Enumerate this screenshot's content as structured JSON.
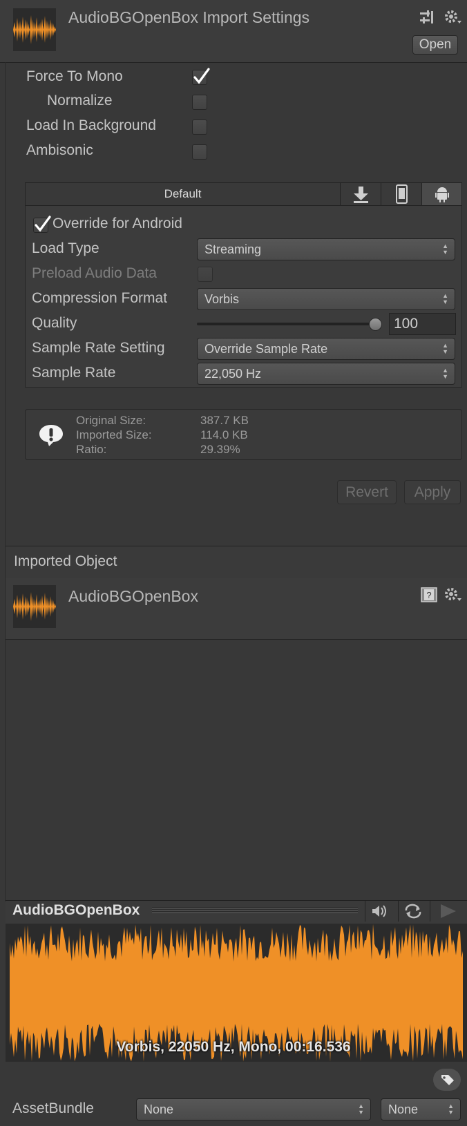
{
  "header": {
    "title": "AudioBGOpenBox Import Settings",
    "open_label": "Open",
    "icons": [
      "preset-sliders-icon",
      "gear-icon"
    ]
  },
  "options": {
    "force_to_mono": {
      "label": "Force To Mono",
      "checked": true
    },
    "normalize": {
      "label": "Normalize",
      "checked": false
    },
    "load_in_background": {
      "label": "Load In Background",
      "checked": false
    },
    "ambisonic": {
      "label": "Ambisonic",
      "checked": false
    }
  },
  "platform_tabs": {
    "default_label": "Default",
    "icons": [
      "download-icon",
      "mobile-phone-icon",
      "android-icon"
    ]
  },
  "android": {
    "override_label": "Override for Android",
    "override_checked": true,
    "load_type_label": "Load Type",
    "load_type_value": "Streaming",
    "preload_label": "Preload Audio Data",
    "compression_label": "Compression Format",
    "compression_value": "Vorbis",
    "quality_label": "Quality",
    "quality_value": "100",
    "sample_rate_setting_label": "Sample Rate Setting",
    "sample_rate_setting_value": "Override Sample Rate",
    "sample_rate_label": "Sample Rate",
    "sample_rate_value": "22,050 Hz"
  },
  "info": {
    "original_label": "Original Size:",
    "original_value": "387.7 KB",
    "imported_label": "Imported Size:",
    "imported_value": "114.0 KB",
    "ratio_label": "Ratio:",
    "ratio_value": "29.39%"
  },
  "actions": {
    "revert": "Revert",
    "apply": "Apply"
  },
  "imported_object": {
    "section_title": "Imported Object",
    "name": "AudioBGOpenBox",
    "icons": [
      "help-book-icon",
      "gear-icon"
    ]
  },
  "preview": {
    "title": "AudioBGOpenBox",
    "caption": "Vorbis, 22050 Hz, Mono, 00:16.536",
    "icons": [
      "speaker-icon",
      "loop-icon",
      "play-icon",
      "tag-icon"
    ],
    "waveform_color": "#ef9027"
  },
  "asset_bundle": {
    "label": "AssetBundle",
    "name_value": "None",
    "variant_value": "None"
  },
  "colors": {
    "background": "#383838",
    "accent_orange": "#ef9027"
  }
}
